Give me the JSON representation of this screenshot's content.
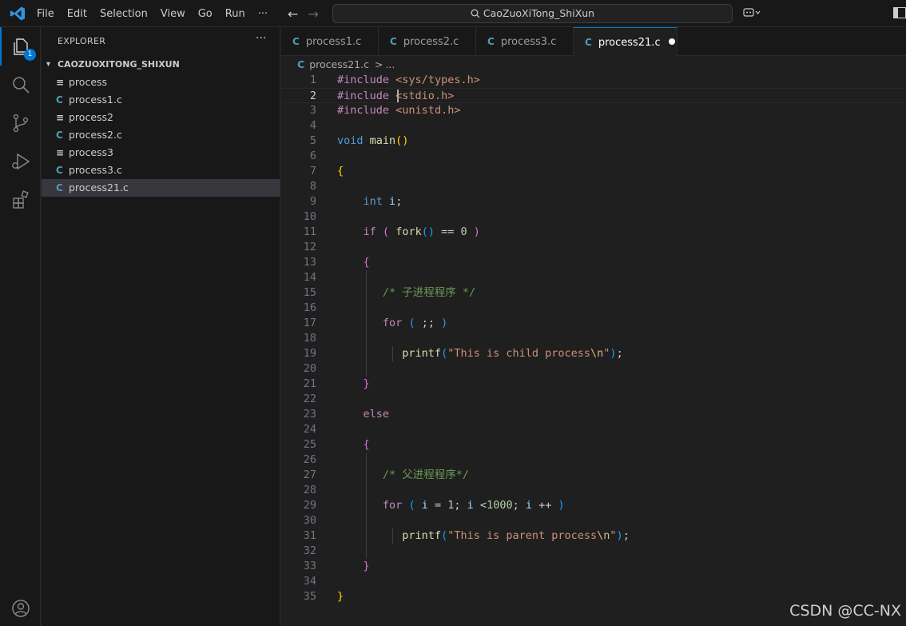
{
  "titlebar": {
    "menu": [
      "File",
      "Edit",
      "Selection",
      "View",
      "Go",
      "Run",
      "···"
    ],
    "search_text": "CaoZuoXiTong_ShiXun"
  },
  "activity": {
    "explorer_badge": "1"
  },
  "sidebar": {
    "title": "EXPLORER",
    "more": "···",
    "folder": "CAOZUOXITONG_SHIXUN",
    "files": [
      {
        "name": "process",
        "type": "txt",
        "selected": false
      },
      {
        "name": "process1.c",
        "type": "c",
        "selected": false
      },
      {
        "name": "process2",
        "type": "txt",
        "selected": false
      },
      {
        "name": "process2.c",
        "type": "c",
        "selected": false
      },
      {
        "name": "process3",
        "type": "txt",
        "selected": false
      },
      {
        "name": "process3.c",
        "type": "c",
        "selected": false
      },
      {
        "name": "process21.c",
        "type": "c",
        "selected": true
      }
    ]
  },
  "tabs": [
    {
      "label": "process1.c",
      "active": false,
      "modified": false
    },
    {
      "label": "process2.c",
      "active": false,
      "modified": false
    },
    {
      "label": "process3.c",
      "active": false,
      "modified": false
    },
    {
      "label": "process21.c",
      "active": true,
      "modified": true
    }
  ],
  "breadcrumb": {
    "file": "process21.c",
    "sep": ">",
    "rest": "..."
  },
  "editor": {
    "current_line": 2,
    "lines": [
      "#include <sys/types.h>",
      "#include <stdio.h>",
      "#include <unistd.h>",
      "",
      "void main()",
      "",
      "{",
      "",
      "    int i;",
      "",
      "    if ( fork() == 0 )",
      "",
      "    {",
      "",
      "       /* 子进程程序 */",
      "",
      "       for ( ;; )",
      "",
      "          printf(\"This is child process\\n\");",
      "",
      "    }",
      "",
      "    else",
      "",
      "    {",
      "",
      "       /* 父进程程序*/",
      "",
      "       for ( i = 1; i <1000; i ++ )",
      "",
      "          printf(\"This is parent process\\n\");",
      "",
      "    }",
      "",
      "}"
    ]
  },
  "watermark": "CSDN @CC-NX"
}
